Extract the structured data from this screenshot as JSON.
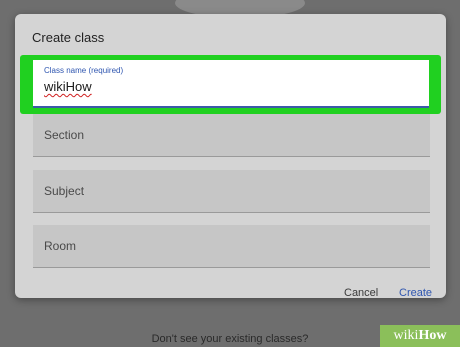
{
  "dialog": {
    "title": "Create class",
    "fields": [
      {
        "label": "Class name (required)",
        "value": "wikiHow"
      },
      {
        "placeholder": "Section"
      },
      {
        "placeholder": "Subject"
      },
      {
        "placeholder": "Room"
      }
    ],
    "actions": {
      "cancel_label": "Cancel",
      "create_label": "Create"
    }
  },
  "backdrop": {
    "text": "Don't see your existing classes?"
  },
  "watermark": {
    "wiki": "wiki",
    "how": "How"
  },
  "colors": {
    "highlight": "#20d020",
    "accent": "#2f56b0",
    "dialog_bg": "#d4d4d4",
    "overlay": "#6e6e6e"
  }
}
